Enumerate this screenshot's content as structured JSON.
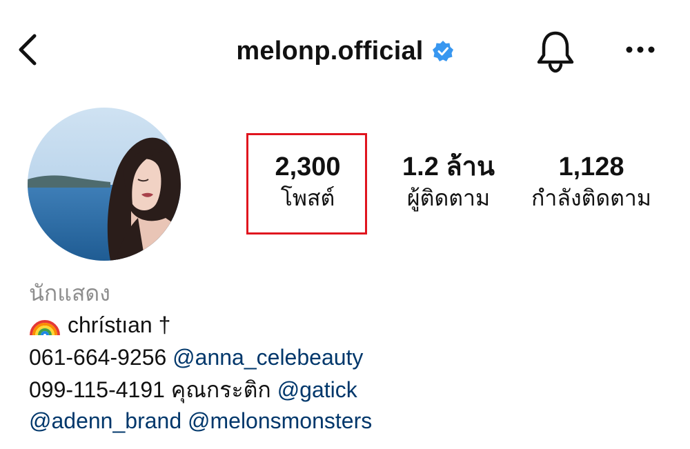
{
  "header": {
    "username": "melonp.official",
    "icons": {
      "back": "chevron-left-icon",
      "verified": "verified-badge-icon",
      "notifications": "bell-icon",
      "more": "more-horizontal-icon"
    }
  },
  "colors": {
    "verified": "#3897f0",
    "link": "#00376b",
    "highlight_box": "#e0141e",
    "category_text": "#8e8e8e"
  },
  "profile": {
    "avatar": "profile-photo"
  },
  "stats": [
    {
      "value": "2,300",
      "label": "โพสต์"
    },
    {
      "value": "1.2 ล้าน",
      "label": "ผู้ติดตาม"
    },
    {
      "value": "1,128",
      "label": "กำลังติดตาม"
    }
  ],
  "bio": {
    "category": "นักแสดง",
    "line1": {
      "emoji": "rainbow-icon",
      "text": "chrístıan †"
    },
    "line2": {
      "phone": "061-664-9256",
      "mention": "@anna_celebeauty"
    },
    "line3": {
      "phone": "099-115-4191",
      "text": "คุณกระติก",
      "mention": "@gatick"
    },
    "line4": {
      "mention1": "@adenn_brand",
      "mention2": "@melonsmonsters"
    }
  }
}
